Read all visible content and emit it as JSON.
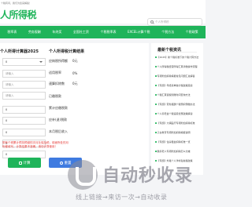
{
  "topbar": {
    "text": "个税有问，我们为您来解答！"
  },
  "header": {
    "logo_text": "人所得税",
    "search_placeholder": "个人所得税"
  },
  "nav": [
    "税率表",
    "劳务报酬",
    "年终奖",
    "全国社工资",
    "个税税率表",
    "EXCEL计算个税",
    "个税方法",
    "个税政策"
  ],
  "calculator": {
    "title": "个人所得计算器2025",
    "fields": [
      {
        "value": "0",
        "type": "select"
      },
      {
        "value": "",
        "placeholder": "请输入"
      },
      {
        "value": "",
        "placeholder": "请输入"
      },
      {
        "value": "",
        "placeholder": "请输入"
      },
      {
        "value": "0"
      },
      {
        "value": "0"
      },
      {
        "value": "0"
      },
      {
        "value": "0"
      },
      {
        "value": "0"
      }
    ],
    "tip": "带有个税累计预扣预缴的次月社保及税，前面所处的月份都填写，计算结果不准确，请勿计算使用！",
    "calc_button": "计算",
    "reset_button": "重置"
  },
  "results": {
    "title": "个人所得税计算结果",
    "rows": [
      {
        "label": "应纳税所得额",
        "value": "0元"
      },
      {
        "label": "适用税率",
        "value": "0%"
      },
      {
        "label": "速算扣除数",
        "value": "0元"
      },
      {
        "label": "已缴税款",
        "value": ""
      },
      {
        "label": "累计应缴税款",
        "value": ""
      },
      {
        "label": "应补(退)税款",
        "value": ""
      },
      {
        "label": "本月税后收入",
        "value": ""
      }
    ]
  },
  "sidebar": {
    "title": "最新个税资讯",
    "news": [
      "【2025】新个税标准下的个税计算方法",
      "个人所得税经营所得汇算清缴操作流程",
      "专项附加扣除填报常见问题汇总解答",
      "【专题】年终奖单独计税政策延续",
      "个税汇算退税到账时间查询方法",
      "【专题】劳务报酬个税预扣预缴办法",
      "个人养老金个税递延优惠政策解读",
      "【专题】大病医疗专项附加扣除标准",
      "子女教育专项附加扣除填报说明",
      "【专题】住房租金扣除标准一览",
      "赡养老人专项附加扣除怎么分摊",
      "【专题】外籍个人津补贴免税政策"
    ]
  },
  "watermark": {
    "big": "自动秒收录",
    "small": "线上链接→来访一次→自动收录"
  },
  "colors": {
    "brand": "#1fb45a",
    "reset": "#3f7be0",
    "tip": "#e53935"
  }
}
